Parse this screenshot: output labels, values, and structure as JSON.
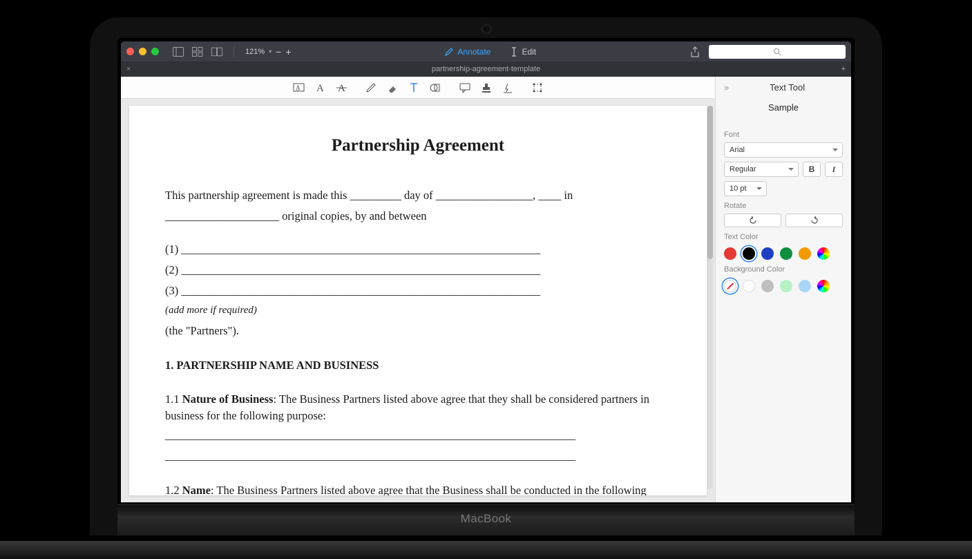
{
  "titlebar": {
    "zoom": "121%",
    "annotate": "Annotate",
    "edit": "Edit",
    "search_placeholder": ""
  },
  "tabs": {
    "title": "partnership-agreement-template"
  },
  "document": {
    "title": "Partnership Agreement",
    "intro_1": "This partnership agreement is made this _________ day of _________________, ____ in",
    "intro_2": "____________________ original copies, by and between",
    "line1": "(1) _______________________________________________________________",
    "line2": "(2) _______________________________________________________________",
    "line3": "(3) _______________________________________________________________",
    "add_more": "(add more if required)",
    "the_partners": "(the \"Partners\").",
    "h1": "1. PARTNERSHIP NAME AND BUSINESS",
    "p11_prefix": "1.1 ",
    "p11_bold": "Nature of Business",
    "p11_rest": ": The Business Partners listed above agree that they shall be considered partners in business for the following purpose:",
    "blank_a": "________________________________________________________________________",
    "blank_b": "________________________________________________________________________",
    "p12_prefix": "1.2 ",
    "p12_bold": "Name",
    "p12_rest": ": The Business Partners listed above agree that the Business shall be conducted in the following name:"
  },
  "sidebar": {
    "title": "Text Tool",
    "sample": "Sample",
    "font_label": "Font",
    "font_value": "Arial",
    "weight_value": "Regular",
    "size_value": "10 pt",
    "rotate_label": "Rotate",
    "text_color_label": "Text Color",
    "bg_color_label": "Background Color",
    "bold_label": "B",
    "italic_label": "I",
    "text_colors": [
      "#E53935",
      "#000000",
      "#1E3FC1",
      "#0E8F3F",
      "#F29A00",
      "rainbow"
    ],
    "bg_colors": [
      "none",
      "#FFFFFF",
      "#BEBEBE",
      "#B6F2C5",
      "#A9D6F5",
      "rainbow"
    ]
  },
  "hinge": {
    "label": "MacBook"
  }
}
